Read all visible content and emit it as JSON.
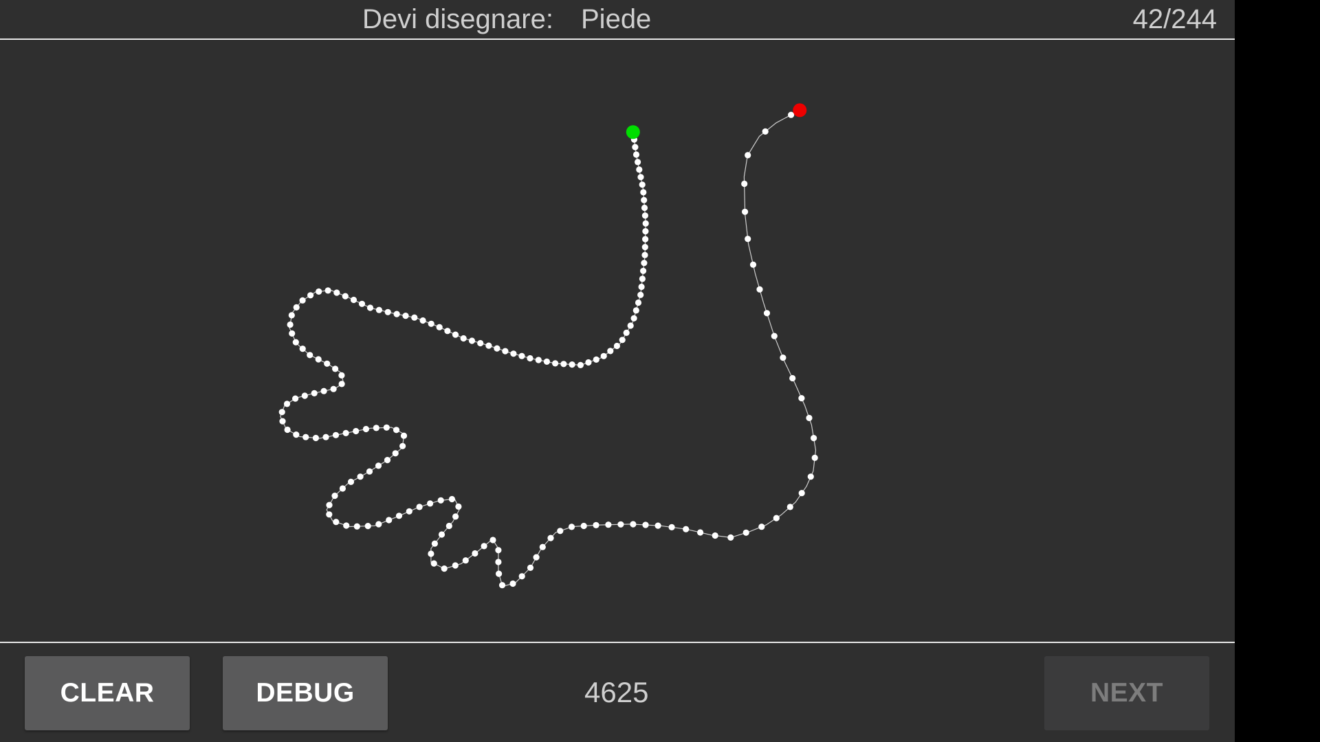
{
  "header": {
    "prompt_label": "Devi disegnare:",
    "prompt_word": "Piede",
    "progress": "42/244"
  },
  "drawing": {
    "stroke_color": "#ffffff",
    "path_line_color": "#cfcfcf",
    "start_marker_color": "#00dd00",
    "end_marker_color": "#ee0000"
  },
  "footer": {
    "clear_label": "CLEAR",
    "debug_label": "DEBUG",
    "score": "4625",
    "next_label": "NEXT",
    "next_enabled": false
  },
  "colors": {
    "background": "#2f2f2f",
    "button": "#5a5a5b",
    "button_disabled": "#3b3b3c",
    "text": "#cfcfcf"
  }
}
